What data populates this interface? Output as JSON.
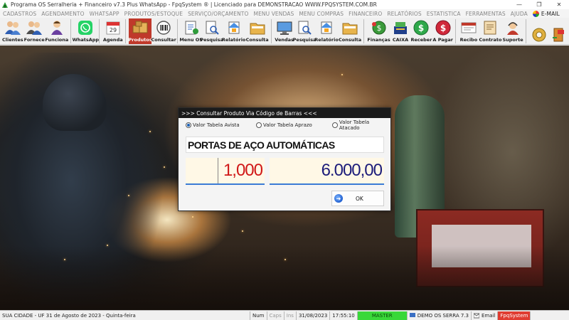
{
  "window": {
    "title": "Programa OS Serralheria + Financeiro v7.3 Plus WhatsApp - FpqSystem ® | Licenciado para  DEMONSTRACAO WWW.FPQSYSTEM.COM.BR",
    "minimize": "—",
    "maximize": "❐",
    "close": "✕"
  },
  "menu": {
    "items": [
      "CADASTROS",
      "AGENDAMENTO",
      "WHATSAPP",
      "PRODUTOS/ESTOQUE",
      "SERVIÇO/ORÇAMENTO",
      "MENU VENDAS",
      "MENU COMPRAS",
      "FINANCEIRO",
      "RELATÓRIOS",
      "ESTATISTICA",
      "FERRAMENTAS",
      "AJUDA"
    ],
    "email": "E-MAIL"
  },
  "toolbar": {
    "clientes": "Clientes",
    "fornece": "Fornece",
    "funciona": "Funciona",
    "whatsapp": "WhatsApp",
    "agenda": "Agenda",
    "produtos": "Produtos",
    "consultar": "Consultar",
    "menu_os": "Menu OS",
    "pesquisa1": "Pesquisa",
    "relatorio1": "Relatório",
    "consulta1": "Consulta",
    "vendas": "Vendas",
    "pesquisa2": "Pesquisa",
    "relatorio2": "Relatório",
    "consulta2": "Consulta",
    "financas": "Finanças",
    "caixa": "CAIXA",
    "receber": "Receber",
    "apagar": "A Pagar",
    "recibo": "Recibo",
    "contrato": "Contrato",
    "suporte": "Suporte",
    "agenda_day": "29"
  },
  "dialog": {
    "title": ">>> Consultar Produto Via Código de Barras <<<",
    "radio_avista": "Valor Tabela Avista",
    "radio_aprazo": "Valor Tabela Aprazo",
    "radio_atacado": "Valor Tabela Atacado",
    "selected_radio": "avista",
    "product_name": "PORTAS DE AÇO AUTOMÁTICAS",
    "quantity": "1,000",
    "price": "6.000,00",
    "ok_label": "OK"
  },
  "status": {
    "location": "SUA CIDADE - UF 31 de Agosto de 2023 - Quinta-feira",
    "num": "Num",
    "caps": "Caps",
    "ins": "Ins",
    "date": "31/08/2023",
    "time": "17:55:10",
    "master": "MASTER",
    "demo": "DEMO OS SERRA 7.3",
    "email": "Email",
    "brand": "FpqSystem"
  },
  "colors": {
    "quantity": "#d01818",
    "price": "#1c1c7a",
    "master_bg": "#39d839",
    "brand_bg": "#e03c31",
    "dialog_title_bg": "#1b1b1b"
  }
}
